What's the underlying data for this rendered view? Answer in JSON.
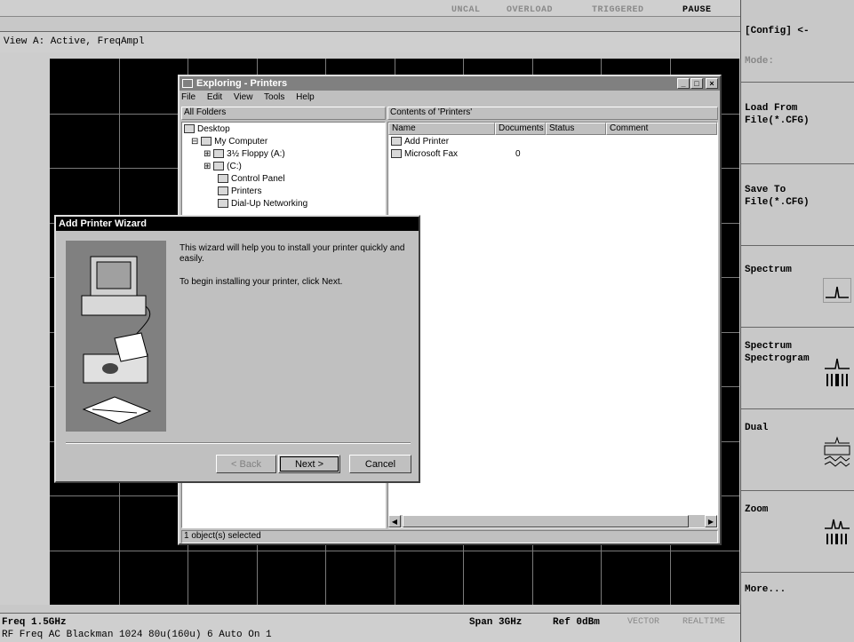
{
  "status_bar": {
    "uncal": "UNCAL",
    "overload": "OVERLOAD",
    "triggered": "TRIGGERED",
    "pause": "PAUSE"
  },
  "view": {
    "label": "View A: Active, FreqAmpl"
  },
  "bottom": {
    "freq": "Freq 1.5GHz",
    "rf_line": "RF Freq AC Blackman 1024 80u(160u) 6 Auto On 1",
    "span": "Span 3GHz",
    "ref": "Ref 0dBm",
    "vector": "VECTOR",
    "realtime": "REALTIME"
  },
  "softkeys": {
    "config": "[Config] <-",
    "mode": "Mode:",
    "load": "Load From\nFile(*.CFG)",
    "save": "Save To\nFile(*.CFG)",
    "spectrum": "Spectrum",
    "spectrogram": "Spectrum\nSpectrogram",
    "dual": "Dual",
    "zoom": "Zoom",
    "more": "More..."
  },
  "explorer": {
    "title": "Exploring - Printers",
    "menu": [
      "File",
      "Edit",
      "View",
      "Tools",
      "Help"
    ],
    "left_header": "All Folders",
    "right_header": "Contents of 'Printers'",
    "tree": {
      "desktop": "Desktop",
      "my_computer": "My Computer",
      "floppy": "3½ Floppy (A:)",
      "c_drive": "(C:)",
      "control_panel": "Control Panel",
      "printers": "Printers",
      "dialup": "Dial-Up Networking"
    },
    "columns": [
      "Name",
      "Documents",
      "Status",
      "Comment"
    ],
    "rows": [
      {
        "name": "Add Printer",
        "documents": ""
      },
      {
        "name": "Microsoft Fax",
        "documents": "0"
      }
    ],
    "statusbar": "1 object(s) selected"
  },
  "wizard": {
    "title": "Add Printer Wizard",
    "line1": "This wizard will help you to install your printer quickly and easily.",
    "line2": "To begin installing your printer, click Next.",
    "back": "< Back",
    "next": "Next >",
    "cancel": "Cancel"
  }
}
